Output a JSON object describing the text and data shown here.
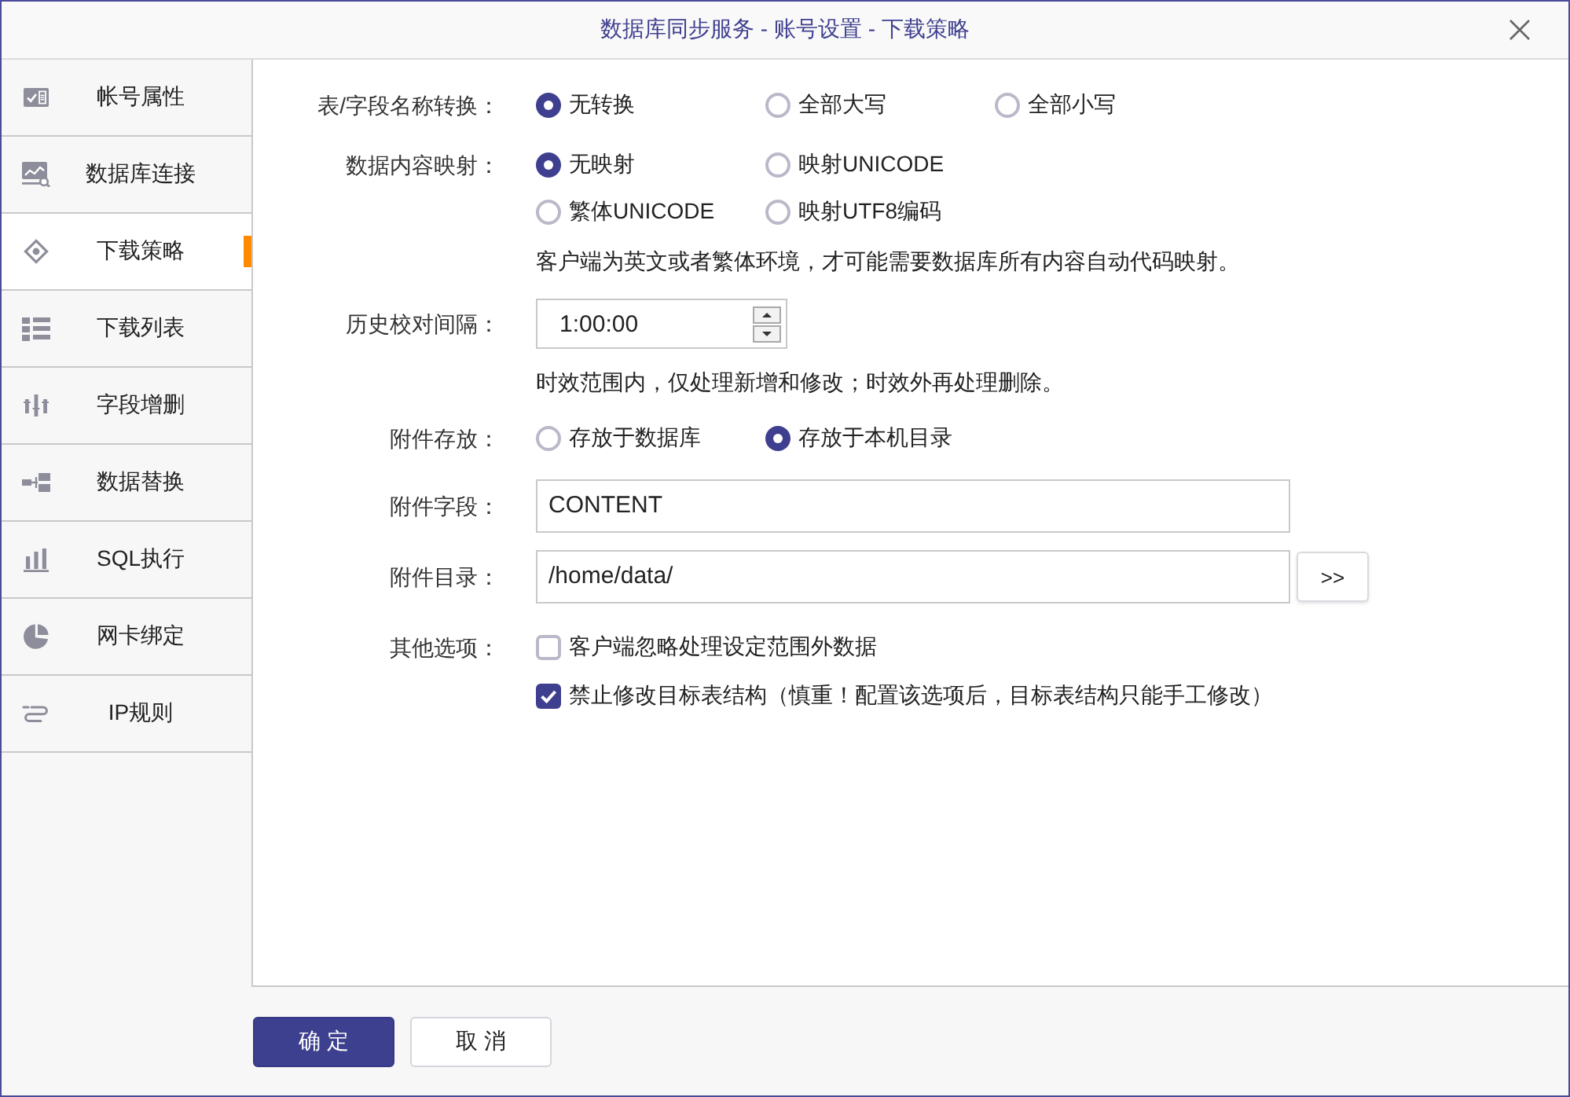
{
  "window": {
    "title": "数据库同步服务 - 账号设置 - 下载策略"
  },
  "sidebar": {
    "items": [
      {
        "label": "帐号属性",
        "selected": false
      },
      {
        "label": "数据库连接",
        "selected": false
      },
      {
        "label": "下载策略",
        "selected": true
      },
      {
        "label": "下载列表",
        "selected": false
      },
      {
        "label": "字段增删",
        "selected": false
      },
      {
        "label": "数据替换",
        "selected": false
      },
      {
        "label": "SQL执行",
        "selected": false
      },
      {
        "label": "网卡绑定",
        "selected": false
      },
      {
        "label": "IP规则",
        "selected": false
      }
    ]
  },
  "form": {
    "rows": [
      {
        "kind": "radio",
        "label": "表/字段名称转换：",
        "option_rows": [
          [
            {
              "label": "无转换",
              "selected": true
            },
            {
              "label": "全部大写",
              "selected": false
            },
            {
              "label": "全部小写",
              "selected": false
            }
          ]
        ]
      },
      {
        "kind": "radio",
        "label": "数据内容映射：",
        "option_rows": [
          [
            {
              "label": "无映射",
              "selected": true
            },
            {
              "label": "映射UNICODE",
              "selected": false
            }
          ],
          [
            {
              "label": "繁体UNICODE",
              "selected": false
            },
            {
              "label": "映射UTF8编码",
              "selected": false
            }
          ]
        ],
        "note": "客户端为英文或者繁体环境，才可能需要数据库所有内容自动代码映射。"
      },
      {
        "kind": "spinner",
        "label": "历史校对间隔：",
        "value": "1:00:00",
        "note": "时效范围内，仅处理新增和修改；时效外再处理删除。"
      },
      {
        "kind": "radio",
        "label": "附件存放：",
        "option_rows": [
          [
            {
              "label": "存放于数据库",
              "selected": false
            },
            {
              "label": "存放于本机目录",
              "selected": true
            }
          ]
        ]
      },
      {
        "kind": "text",
        "label": "附件字段：",
        "value": "CONTENT"
      },
      {
        "kind": "path",
        "label": "附件目录：",
        "value": "/home/data/",
        "button": ">>"
      },
      {
        "kind": "checks",
        "label": "其他选项：",
        "options": [
          {
            "label": "客户端忽略处理设定范围外数据",
            "checked": false
          },
          {
            "label": "禁止修改目标表结构（慎重！配置该选项后，目标表结构只能手工修改）",
            "checked": true
          }
        ]
      }
    ]
  },
  "buttons": [
    {
      "kind": "primary",
      "label": "确 定"
    },
    {
      "kind": "secondary",
      "label": "取 消"
    }
  ]
}
